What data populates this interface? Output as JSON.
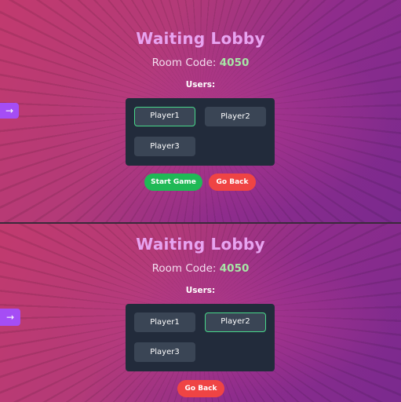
{
  "screens": [
    {
      "title": "Waiting Lobby",
      "room_label": "Room Code:",
      "room_code": "4050",
      "users_label": "Users:",
      "users": [
        "Player1",
        "Player2",
        "Player3"
      ],
      "selected_user": "Player1",
      "arrow": "→",
      "start_button": "Start Game",
      "back_button": "Go Back"
    },
    {
      "title": "Waiting Lobby",
      "room_label": "Room Code:",
      "room_code": "4050",
      "users_label": "Users:",
      "users": [
        "Player1",
        "Player2",
        "Player3"
      ],
      "selected_user": "Player2",
      "arrow": "→",
      "back_button": "Go Back"
    }
  ],
  "colors": {
    "title": "#e7a3f0",
    "room_code": "#a7e6a6",
    "start_button": "#1fb956",
    "back_button": "#ef4444",
    "selected_border": "#48d88a",
    "arrow_button": "#a54df5"
  }
}
